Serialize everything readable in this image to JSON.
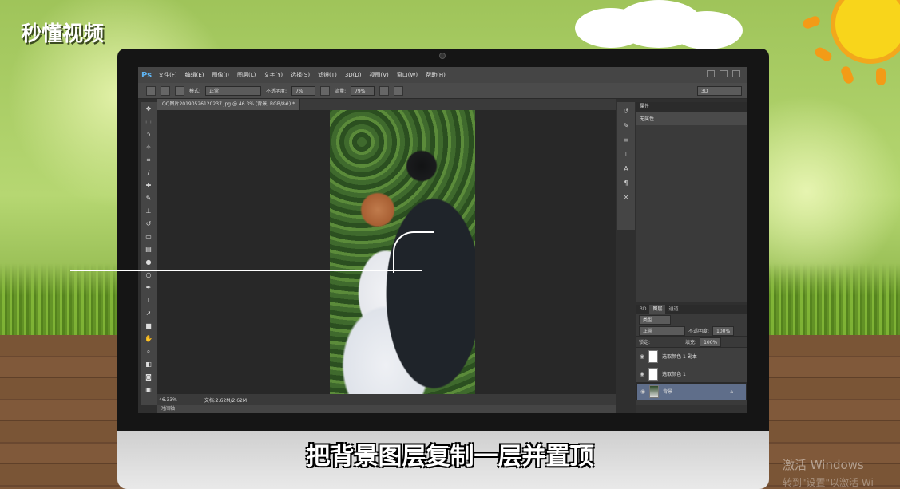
{
  "brand": {
    "logo_text": "秒懂视频"
  },
  "subtitle": "把背景图层复制一层并置顶",
  "watermark": {
    "line1": "激活 Windows",
    "line2": "转到\"设置\"以激活 Wi"
  },
  "photoshop": {
    "logo": "Ps",
    "menu": [
      "文件(F)",
      "编辑(E)",
      "图像(I)",
      "图层(L)",
      "文字(Y)",
      "选择(S)",
      "滤镜(T)",
      "3D(D)",
      "视图(V)",
      "窗口(W)",
      "帮助(H)"
    ],
    "options": {
      "mode_label": "模式:",
      "mode_value": "正常",
      "opacity_label": "不透明度:",
      "opacity_value": "7%",
      "flow_label": "流量:",
      "flow_value": "79%",
      "workspace": "3D"
    },
    "document_tab": "QQ图片20190526120237.jpg @ 46.3% (背景, RGB/8#) *",
    "status": {
      "zoom": "46.33%",
      "doc": "文档:2.62M/2.62M"
    },
    "timeline_label": "时间轴",
    "properties": {
      "tab": "属性",
      "value": "无属性"
    },
    "layers_panel": {
      "tabs": [
        "3D",
        "图层",
        "通道"
      ],
      "active_tab": "图层",
      "filter_label": "类型",
      "blend_mode": "正常",
      "opacity_label": "不透明度:",
      "opacity_value": "100%",
      "lock_label": "锁定:",
      "fill_label": "填充:",
      "fill_value": "100%",
      "layers": [
        {
          "name": "选取颜色 1 副本"
        },
        {
          "name": "选取颜色 1"
        },
        {
          "name": "背景"
        }
      ]
    }
  },
  "colors": {
    "ps_accent": "#5fb3f0",
    "selected_layer": "#5f6e8a",
    "panel_bg": "#3a3a3a"
  }
}
